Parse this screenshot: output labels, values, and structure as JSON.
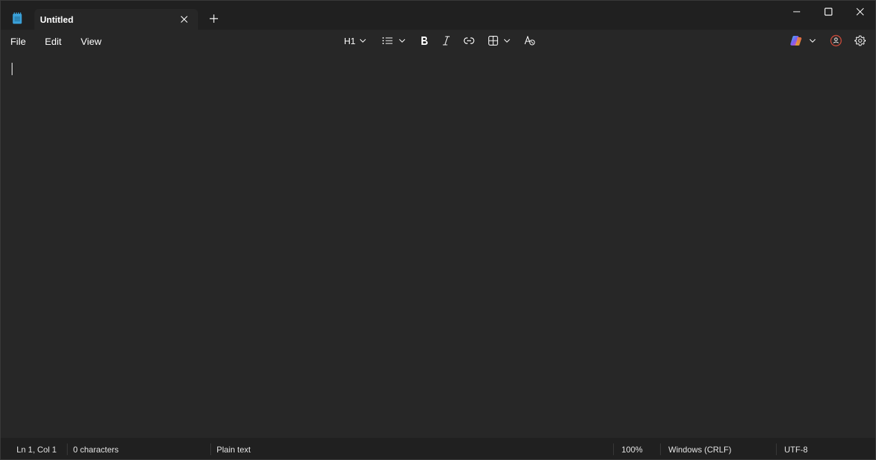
{
  "tab": {
    "title": "Untitled"
  },
  "menu": {
    "file": "File",
    "edit": "Edit",
    "view": "View"
  },
  "toolbar": {
    "heading_label": "H1"
  },
  "status": {
    "position": "Ln 1, Col 1",
    "characters": "0 characters",
    "format": "Plain text",
    "zoom": "100%",
    "line_ending": "Windows (CRLF)",
    "encoding": "UTF-8"
  },
  "icons": {
    "app": "notepad-icon",
    "close_tab": "close-icon",
    "new_tab": "plus-icon",
    "minimize": "minimize-icon",
    "maximize": "maximize-icon",
    "close_window": "close-icon",
    "list": "bulleted-list-icon",
    "bold": "bold-icon",
    "italic": "italic-icon",
    "link": "link-icon",
    "table": "table-icon",
    "clear_formatting": "clear-formatting-icon",
    "copilot": "copilot-icon",
    "account": "account-icon",
    "settings": "gear-icon"
  },
  "colors": {
    "titlebar_bg": "#202020",
    "editor_bg": "#272727",
    "text": "#ffffff",
    "app_icon": "#3aa0d8"
  }
}
